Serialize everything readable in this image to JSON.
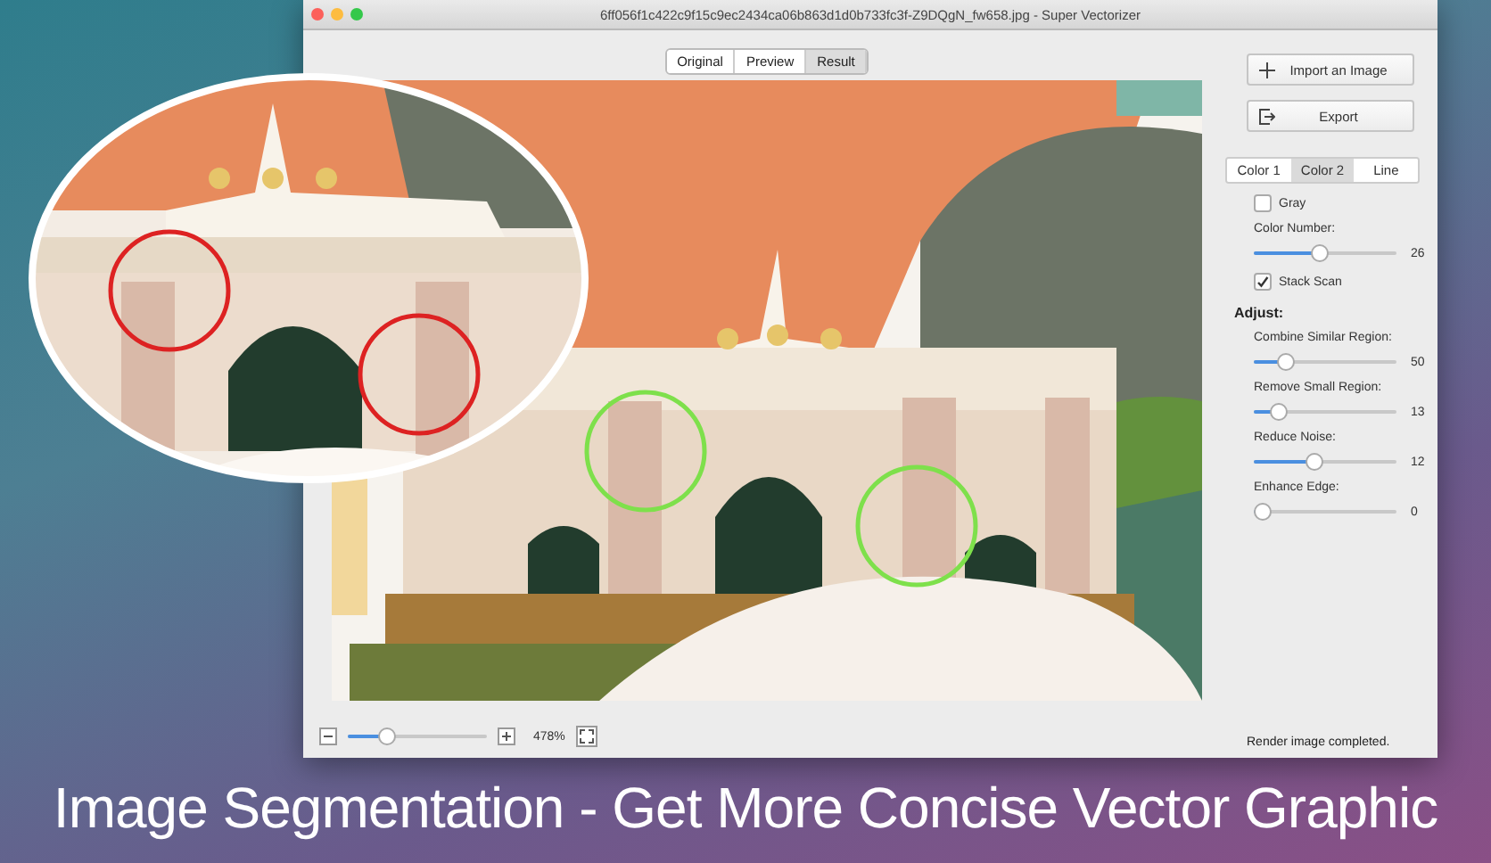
{
  "window": {
    "title": "6ff056f1c422c9f15c9ec2434ca06b863d1d0b733fc3f-Z9DQgN_fw658.jpg - Super Vectorizer"
  },
  "view_tabs": [
    {
      "label": "Original",
      "selected": false
    },
    {
      "label": "Preview",
      "selected": false
    },
    {
      "label": "Result",
      "selected": true
    }
  ],
  "actions": [
    {
      "kind": "import",
      "label": "Import an Image"
    },
    {
      "kind": "export",
      "label": "Export"
    }
  ],
  "color_tabs": [
    {
      "label": "Color 1",
      "selected": false
    },
    {
      "label": "Color 2",
      "selected": true
    },
    {
      "label": "Line",
      "selected": false
    }
  ],
  "options": [
    {
      "kind": "checkbox",
      "label": "Gray",
      "checked": false
    },
    {
      "kind": "slider",
      "label": "Color Number:",
      "level": 0.45,
      "reading": "26"
    },
    {
      "kind": "checkbox",
      "label": "Stack Scan",
      "checked": true
    }
  ],
  "adjust": {
    "heading": "Adjust:",
    "sliders": [
      {
        "label": "Combine Similar Region:",
        "level": 0.18,
        "reading": "50"
      },
      {
        "label": "Remove Small Region:",
        "level": 0.13,
        "reading": "13"
      },
      {
        "label": "Reduce Noise:",
        "level": 0.42,
        "reading": "12"
      },
      {
        "label": "Enhance Edge:",
        "level": 0,
        "reading": "0"
      }
    ]
  },
  "zoom": {
    "level": 0.25,
    "reading": "478%"
  },
  "status_bar": "Render image completed.",
  "caption": "Image Segmentation - Get More Concise Vector Graphic"
}
